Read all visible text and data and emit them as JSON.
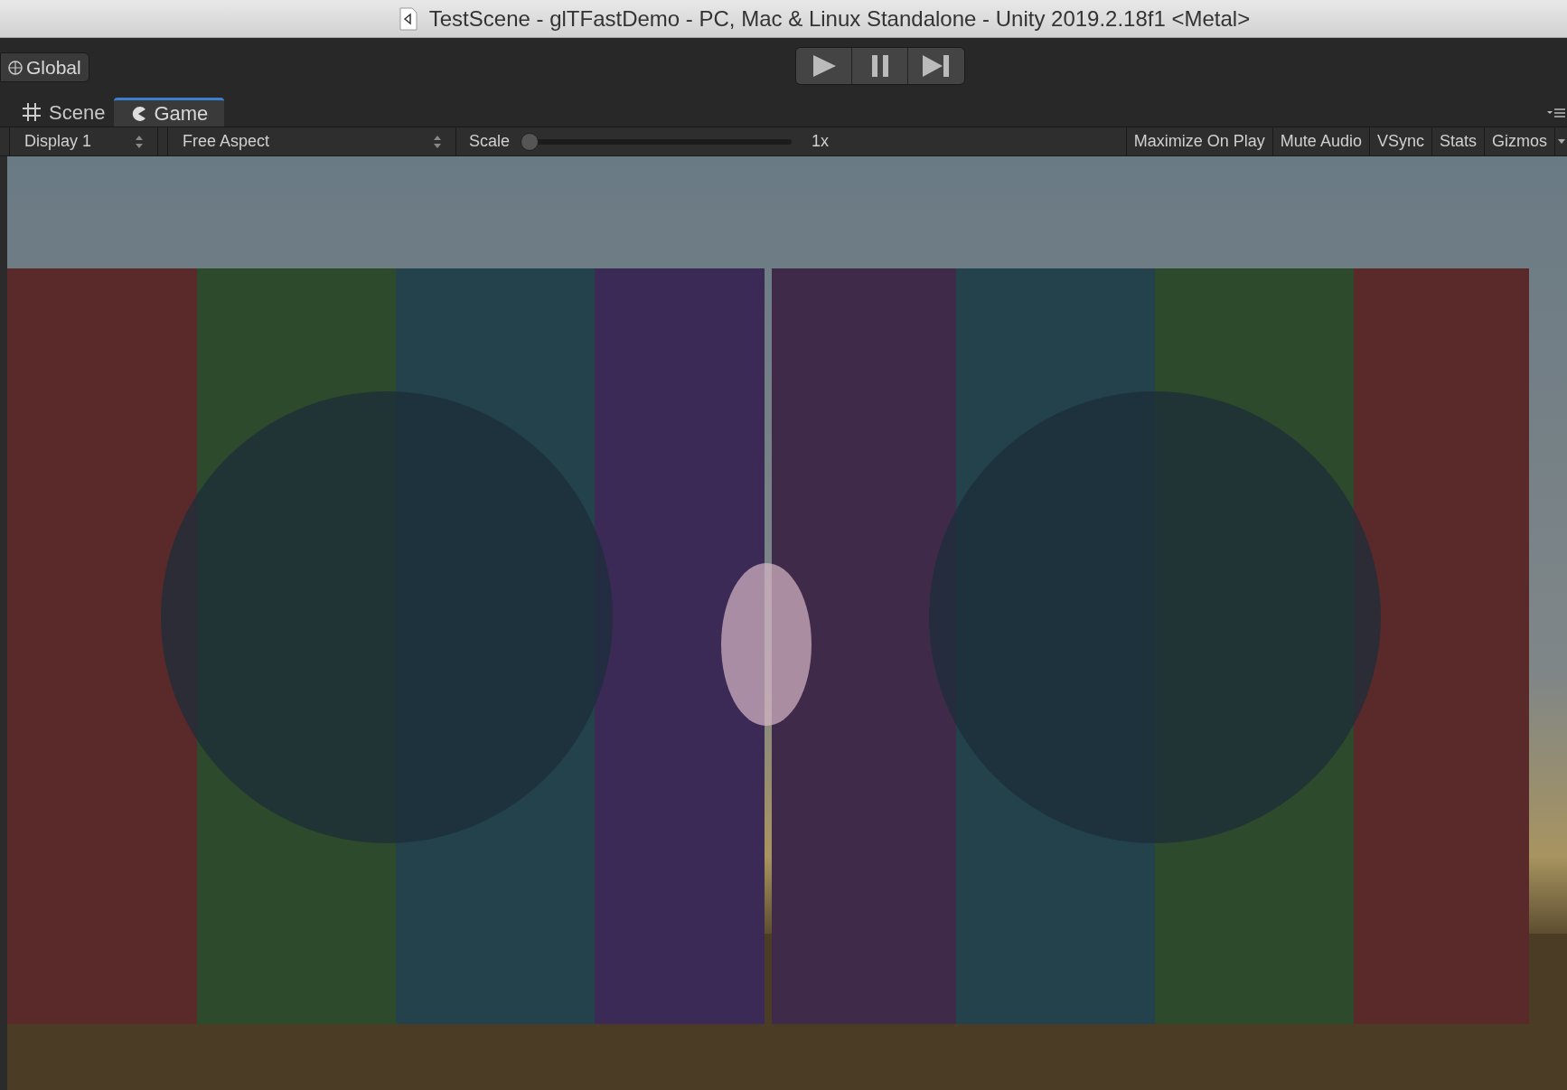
{
  "window": {
    "title": "TestScene - glTFastDemo - PC, Mac & Linux Standalone - Unity 2019.2.18f1 <Metal>"
  },
  "toolbar": {
    "layers_button": "Global"
  },
  "tabs": [
    {
      "label": "Scene",
      "kind": "scene",
      "selected": false
    },
    {
      "label": "Game",
      "kind": "game",
      "selected": true
    }
  ],
  "game_toolbar": {
    "display": "Display 1",
    "aspect": "Free Aspect",
    "scale": {
      "label": "Scale",
      "level": 0,
      "reading": "1x"
    },
    "toggles": [
      {
        "label": "Maximize On Play",
        "on": false
      },
      {
        "label": "Mute Audio",
        "on": false
      },
      {
        "label": "VSync",
        "on": false
      },
      {
        "label": "Stats",
        "on": false
      },
      {
        "label": "Gizmos",
        "on": false
      }
    ]
  }
}
